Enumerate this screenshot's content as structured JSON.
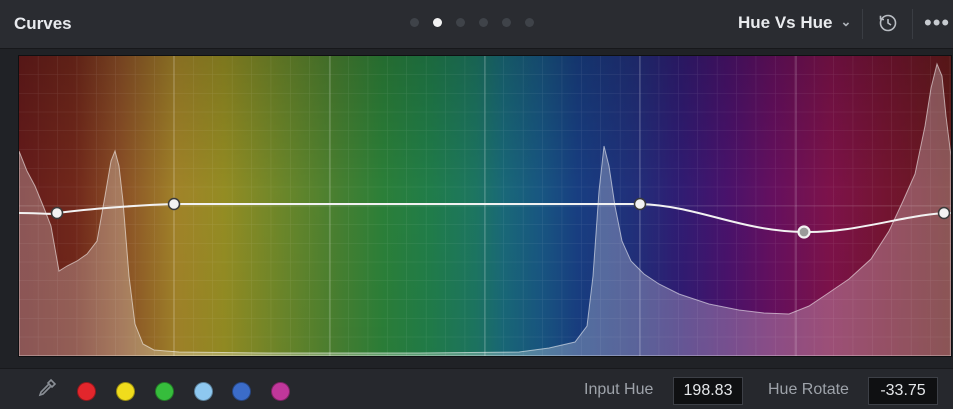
{
  "header": {
    "title": "Curves",
    "mode": "Hue Vs Hue",
    "pager": {
      "count": 6,
      "active_index": 1
    }
  },
  "icons": {
    "mode_dropdown": "chevron-down-icon",
    "reset": "reset-icon",
    "more": "more-options-icon",
    "eyedropper": "eyedropper-icon"
  },
  "graph": {
    "curve_color": "#f2f2f2"
  },
  "swatches": [
    {
      "name": "red",
      "color": "#e3262c"
    },
    {
      "name": "yellow",
      "color": "#f0dc1c"
    },
    {
      "name": "green",
      "color": "#36bd3c"
    },
    {
      "name": "cyan",
      "color": "#8ec8f0"
    },
    {
      "name": "blue",
      "color": "#3b6cc9"
    },
    {
      "name": "magenta",
      "color": "#c0379b"
    }
  ],
  "footer": {
    "input_hue_label": "Input Hue",
    "input_hue_value": "198.83",
    "hue_rotate_label": "Hue Rotate",
    "hue_rotate_value": "-33.75"
  }
}
